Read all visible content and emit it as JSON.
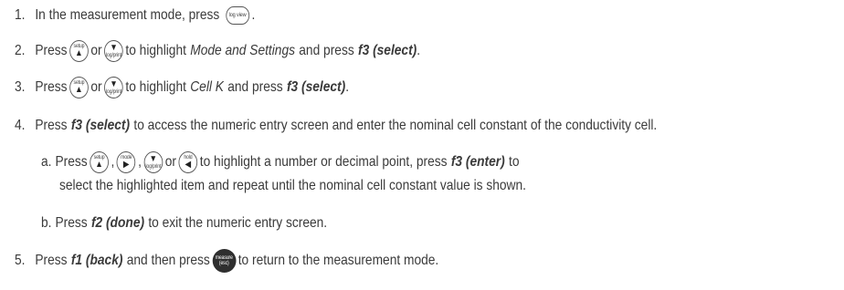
{
  "steps": [
    {
      "num": "1.",
      "t1": "In the measurement mode, press",
      "b1": "log view",
      "t2": "."
    },
    {
      "num": "2.",
      "t1": "Press",
      "b1": "setup",
      "t2": "or",
      "b2": "log/print",
      "t3": "to highlight",
      "em": "Mode and Settings",
      "t4": "and press",
      "key": "f3 (select)",
      "t5": "."
    },
    {
      "num": "3.",
      "t1": "Press",
      "b1": "setup",
      "t2": "or",
      "b2": "log/print",
      "t3": "to highlight",
      "em": "Cell K",
      "t4": "and press",
      "key": "f3 (select)",
      "t5": "."
    },
    {
      "num": "4.",
      "t1": "Press",
      "key": "f3 (select)",
      "t2": "to access the numeric entry screen and enter the nominal cell constant of the conductivity cell."
    },
    {
      "num": "5.",
      "t1": "Press",
      "key": "f1 (back)",
      "t2": "and then press",
      "b1": "measure",
      "b1sub": "(esc)",
      "t3": "to return to the measurement mode."
    }
  ],
  "substeps": [
    {
      "num": "a.",
      "t1": "Press",
      "b1": "setup",
      "b2": "mode",
      "b3": "log/print",
      "t2": "or",
      "b4": "hold",
      "t3": "to highlight a number or decimal point, press",
      "key": "f3 (enter)",
      "t4": "to",
      "line2": "select the highlighted item and repeat until the nominal cell constant value is shown."
    },
    {
      "num": "b.",
      "t1": "Press",
      "key": "f2 (done)",
      "t2": "to exit the numeric entry screen."
    }
  ],
  "icons": {
    "up": "▲",
    "right": "▶",
    "down": "▼",
    "left": "◀"
  }
}
